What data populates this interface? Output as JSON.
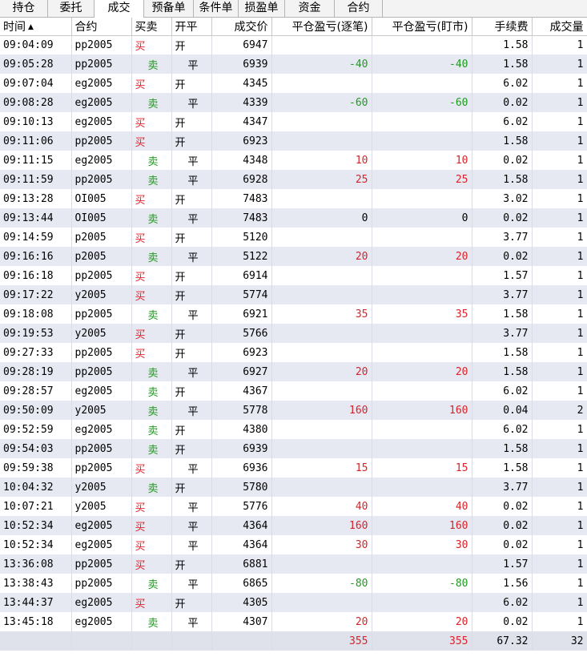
{
  "tabs": [
    "持仓",
    "委托",
    "成交",
    "预备单",
    "条件单",
    "损盈单",
    "资金",
    "合约"
  ],
  "active_tab": 2,
  "columns": {
    "time": "时间",
    "sort_indicator": "▲",
    "contract": "合约",
    "direction": "买卖",
    "open_close": "开平",
    "price": "成交价",
    "pnl_trade": "平仓盈亏(逐笔)",
    "pnl_mark": "平仓盈亏(盯市)",
    "fee": "手续费",
    "qty": "成交量"
  },
  "colors": {
    "buy": "#d9222a",
    "sell": "#1f9a1f",
    "row_alt": "#e6e9f2"
  },
  "rows": [
    {
      "time": "09:04:09",
      "contract": "pp2005",
      "dir": "买",
      "oc": "开",
      "price": "6947",
      "pnl1": "",
      "pnl2": "",
      "fee": "1.58",
      "qty": "1"
    },
    {
      "time": "09:05:28",
      "contract": "pp2005",
      "dir": "卖",
      "oc": "平",
      "price": "6939",
      "pnl1": "-40",
      "pnl2": "-40",
      "fee": "1.58",
      "qty": "1"
    },
    {
      "time": "09:07:04",
      "contract": "eg2005",
      "dir": "买",
      "oc": "开",
      "price": "4345",
      "pnl1": "",
      "pnl2": "",
      "fee": "6.02",
      "qty": "1"
    },
    {
      "time": "09:08:28",
      "contract": "eg2005",
      "dir": "卖",
      "oc": "平",
      "price": "4339",
      "pnl1": "-60",
      "pnl2": "-60",
      "fee": "0.02",
      "qty": "1"
    },
    {
      "time": "09:10:13",
      "contract": "eg2005",
      "dir": "买",
      "oc": "开",
      "price": "4347",
      "pnl1": "",
      "pnl2": "",
      "fee": "6.02",
      "qty": "1"
    },
    {
      "time": "09:11:06",
      "contract": "pp2005",
      "dir": "买",
      "oc": "开",
      "price": "6923",
      "pnl1": "",
      "pnl2": "",
      "fee": "1.58",
      "qty": "1"
    },
    {
      "time": "09:11:15",
      "contract": "eg2005",
      "dir": "卖",
      "oc": "平",
      "price": "4348",
      "pnl1": "10",
      "pnl2": "10",
      "fee": "0.02",
      "qty": "1"
    },
    {
      "time": "09:11:59",
      "contract": "pp2005",
      "dir": "卖",
      "oc": "平",
      "price": "6928",
      "pnl1": "25",
      "pnl2": "25",
      "fee": "1.58",
      "qty": "1"
    },
    {
      "time": "09:13:28",
      "contract": "OI005",
      "dir": "买",
      "oc": "开",
      "price": "7483",
      "pnl1": "",
      "pnl2": "",
      "fee": "3.02",
      "qty": "1"
    },
    {
      "time": "09:13:44",
      "contract": "OI005",
      "dir": "卖",
      "oc": "平",
      "price": "7483",
      "pnl1": "0",
      "pnl2": "0",
      "fee": "0.02",
      "qty": "1"
    },
    {
      "time": "09:14:59",
      "contract": "p2005",
      "dir": "买",
      "oc": "开",
      "price": "5120",
      "pnl1": "",
      "pnl2": "",
      "fee": "3.77",
      "qty": "1"
    },
    {
      "time": "09:16:16",
      "contract": "p2005",
      "dir": "卖",
      "oc": "平",
      "price": "5122",
      "pnl1": "20",
      "pnl2": "20",
      "fee": "0.02",
      "qty": "1"
    },
    {
      "time": "09:16:18",
      "contract": "pp2005",
      "dir": "买",
      "oc": "开",
      "price": "6914",
      "pnl1": "",
      "pnl2": "",
      "fee": "1.57",
      "qty": "1"
    },
    {
      "time": "09:17:22",
      "contract": "y2005",
      "dir": "买",
      "oc": "开",
      "price": "5774",
      "pnl1": "",
      "pnl2": "",
      "fee": "3.77",
      "qty": "1"
    },
    {
      "time": "09:18:08",
      "contract": "pp2005",
      "dir": "卖",
      "oc": "平",
      "price": "6921",
      "pnl1": "35",
      "pnl2": "35",
      "fee": "1.58",
      "qty": "1"
    },
    {
      "time": "09:19:53",
      "contract": "y2005",
      "dir": "买",
      "oc": "开",
      "price": "5766",
      "pnl1": "",
      "pnl2": "",
      "fee": "3.77",
      "qty": "1"
    },
    {
      "time": "09:27:33",
      "contract": "pp2005",
      "dir": "买",
      "oc": "开",
      "price": "6923",
      "pnl1": "",
      "pnl2": "",
      "fee": "1.58",
      "qty": "1"
    },
    {
      "time": "09:28:19",
      "contract": "pp2005",
      "dir": "卖",
      "oc": "平",
      "price": "6927",
      "pnl1": "20",
      "pnl2": "20",
      "fee": "1.58",
      "qty": "1"
    },
    {
      "time": "09:28:57",
      "contract": "eg2005",
      "dir": "卖",
      "oc": "开",
      "price": "4367",
      "pnl1": "",
      "pnl2": "",
      "fee": "6.02",
      "qty": "1"
    },
    {
      "time": "09:50:09",
      "contract": "y2005",
      "dir": "卖",
      "oc": "平",
      "price": "5778",
      "pnl1": "160",
      "pnl2": "160",
      "fee": "0.04",
      "qty": "2"
    },
    {
      "time": "09:52:59",
      "contract": "eg2005",
      "dir": "卖",
      "oc": "开",
      "price": "4380",
      "pnl1": "",
      "pnl2": "",
      "fee": "6.02",
      "qty": "1"
    },
    {
      "time": "09:54:03",
      "contract": "pp2005",
      "dir": "卖",
      "oc": "开",
      "price": "6939",
      "pnl1": "",
      "pnl2": "",
      "fee": "1.58",
      "qty": "1"
    },
    {
      "time": "09:59:38",
      "contract": "pp2005",
      "dir": "买",
      "oc": "平",
      "price": "6936",
      "pnl1": "15",
      "pnl2": "15",
      "fee": "1.58",
      "qty": "1"
    },
    {
      "time": "10:04:32",
      "contract": "y2005",
      "dir": "卖",
      "oc": "开",
      "price": "5780",
      "pnl1": "",
      "pnl2": "",
      "fee": "3.77",
      "qty": "1"
    },
    {
      "time": "10:07:21",
      "contract": "y2005",
      "dir": "买",
      "oc": "平",
      "price": "5776",
      "pnl1": "40",
      "pnl2": "40",
      "fee": "0.02",
      "qty": "1"
    },
    {
      "time": "10:52:34",
      "contract": "eg2005",
      "dir": "买",
      "oc": "平",
      "price": "4364",
      "pnl1": "160",
      "pnl2": "160",
      "fee": "0.02",
      "qty": "1"
    },
    {
      "time": "10:52:34",
      "contract": "eg2005",
      "dir": "买",
      "oc": "平",
      "price": "4364",
      "pnl1": "30",
      "pnl2": "30",
      "fee": "0.02",
      "qty": "1"
    },
    {
      "time": "13:36:08",
      "contract": "pp2005",
      "dir": "买",
      "oc": "开",
      "price": "6881",
      "pnl1": "",
      "pnl2": "",
      "fee": "1.57",
      "qty": "1"
    },
    {
      "time": "13:38:43",
      "contract": "pp2005",
      "dir": "卖",
      "oc": "平",
      "price": "6865",
      "pnl1": "-80",
      "pnl2": "-80",
      "fee": "1.56",
      "qty": "1"
    },
    {
      "time": "13:44:37",
      "contract": "eg2005",
      "dir": "买",
      "oc": "开",
      "price": "4305",
      "pnl1": "",
      "pnl2": "",
      "fee": "6.02",
      "qty": "1"
    },
    {
      "time": "13:45:18",
      "contract": "eg2005",
      "dir": "卖",
      "oc": "平",
      "price": "4307",
      "pnl1": "20",
      "pnl2": "20",
      "fee": "0.02",
      "qty": "1"
    }
  ],
  "totals": {
    "pnl1": "355",
    "pnl2": "355",
    "fee": "67.32",
    "qty": "32"
  }
}
